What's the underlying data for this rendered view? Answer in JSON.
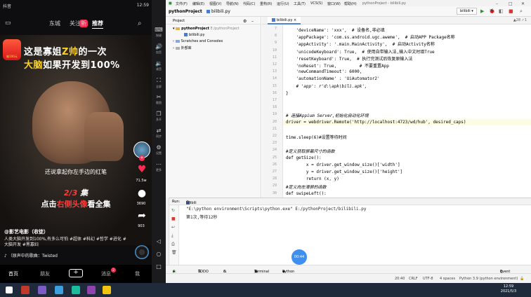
{
  "phone": {
    "status_left": "抖音",
    "status_right": "12:59",
    "live_icon": "live-tv-icon",
    "tabs": [
      {
        "label": "东城"
      },
      {
        "label": "关注"
      },
      {
        "label": "推荐"
      }
    ],
    "new_badge": "新",
    "ad_logo_text": "抽100元",
    "banner_line1_prefix": "这是寡姐",
    "banner_line1_highlight": "Z帅",
    "banner_line1_suffix": "的一次",
    "banner_line2_highlight": "大脑",
    "banner_line2_suffix": "如果开发到100%",
    "subtitle": "还说拿起你左手边的红笔",
    "episode": "2/3",
    "episode_suffix": " 集",
    "cta_prefix": "点击",
    "cta_highlight": "右侧头像",
    "cta_suffix": "看全集",
    "rail": {
      "like_count": "71.5w",
      "comment_count": "3690",
      "share_count": "903"
    },
    "author": "@影艺电影（收徒）",
    "description": "人类大脑开发到100%,有多么可怕 #超体 #科幻 #哲学 #进化 #大脑开发 #黑寡妇",
    "music": "（原声中的歌曲：Twisted",
    "bottom_nav": [
      {
        "label": "首页"
      },
      {
        "label": "朋友"
      },
      {
        "label": "+"
      },
      {
        "label": "消息"
      },
      {
        "label": "我"
      }
    ],
    "msg_badge": "2"
  },
  "emulator_toolbar": [
    {
      "icon": "keyboard-icon",
      "label": "按键"
    },
    {
      "icon": "volume-up-icon",
      "label": "加音"
    },
    {
      "icon": "volume-down-icon",
      "label": "减音"
    },
    {
      "icon": "fullscreen-icon",
      "label": "全屏"
    },
    {
      "icon": "screenshot-icon",
      "label": "截图"
    },
    {
      "icon": "multi-instance-icon",
      "label": "多开"
    },
    {
      "icon": "sync-icon",
      "label": "同步"
    },
    {
      "icon": "settings-icon",
      "label": "设置"
    },
    {
      "icon": "more-icon",
      "label": "更多"
    }
  ],
  "ide": {
    "menu": [
      "文件(F)",
      "编辑(E)",
      "视图(V)",
      "导航(N)",
      "代码(C)",
      "重构(R)",
      "运行(U)",
      "工具(T)",
      "VCS(S)",
      "窗口(W)",
      "帮助(H)"
    ],
    "window_title": "pythonProject - bilibili.py",
    "breadcrumb_project": "pythonProject",
    "breadcrumb_file": "bilibili.py",
    "run_config": "bilibili",
    "project_panel": {
      "title": "Project",
      "root": "pythonProject",
      "root_path": "E:/pythonProject",
      "file": "bilibili.py",
      "scratches": "Scratches and Consoles",
      "external": "外部库"
    },
    "editor_tab": "bilibili.py",
    "indicators": "▲28 ✓1",
    "lines": [
      {
        "num": "7",
        "text": "    'deviceName': 'xxx',  # 设备名,非必填"
      },
      {
        "num": "8",
        "text": "    'appPackage': 'com.ss.android.ugc.aweme',  # 启动APP Package名称"
      },
      {
        "num": "9",
        "text": "    'appActivity': '.main.MainActivity',  # 启动Activity名称"
      },
      {
        "num": "10",
        "text": "    'unicodeKeyboard': True,  # 使用自带输入法,输入中文时填True"
      },
      {
        "num": "11",
        "text": "    'resetKeyboard': True,  # 执行完测试后恢复原输入法"
      },
      {
        "num": "12",
        "text": "    'noReset': True,         # 不要重置App"
      },
      {
        "num": "13",
        "text": "    'newCommandTimeout': 6000,"
      },
      {
        "num": "14",
        "text": "    'automationName' : 'UiAutomator2'"
      },
      {
        "num": "15",
        "text": "    # 'app': r'd:\\apk\\bili.apk',"
      },
      {
        "num": "16",
        "text": "}"
      },
      {
        "num": "17",
        "text": ""
      },
      {
        "num": "18",
        "text": ""
      },
      {
        "num": "19",
        "text": "# 连接Appium Server,初始化自动化环境"
      },
      {
        "num": "20",
        "text": "driver = webdriver.Remote('http://localhost:4723/wd/hub', desired_caps)"
      },
      {
        "num": "21",
        "text": ""
      },
      {
        "num": "22",
        "text": "time.sleep(6)#设置等待时间"
      },
      {
        "num": "23",
        "text": ""
      },
      {
        "num": "24",
        "text": "#定义获取屏幕尺寸的函数"
      },
      {
        "num": "25",
        "text": "def getSize():"
      },
      {
        "num": "26",
        "text": "        x = driver.get_window_size()['width']"
      },
      {
        "num": "27",
        "text": "        y = driver.get_window_size()['height']"
      },
      {
        "num": "28",
        "text": "        return (x, y)"
      },
      {
        "num": "29",
        "text": "#定义向左滑屏的函数"
      },
      {
        "num": "30",
        "text": "def swipeLeft():"
      }
    ],
    "run_tab_label": "Run:",
    "run_tab_name": "bilibili",
    "console": [
      "\"E:\\python environment\\Scripts\\python.exe\" E:/pythonProject/bilibili.py",
      "第1次,等待12秒"
    ],
    "timer": "00:44",
    "bottom_tabs": [
      "4: Run",
      "TODO",
      "6: Problems",
      "Terminal",
      "Python Console"
    ],
    "event_log": "Event Log",
    "status": {
      "position": "20:40",
      "line_sep": "CRLF",
      "encoding": "UTF-8",
      "indent": "4 spaces",
      "interpreter": "Python 3.9 (python environment)"
    }
  },
  "taskbar": {
    "time": "12:59",
    "date": "2021/5/3",
    "icon_colors": [
      "#c0392b",
      "#7b5cc4",
      "#3aa0e0",
      "#1abc9c",
      "#8e44ad",
      "#f1c40f"
    ]
  }
}
